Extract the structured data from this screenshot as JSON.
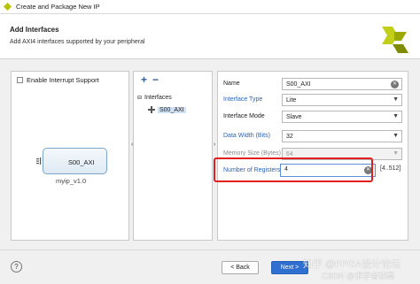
{
  "window": {
    "title": "Create and Package New IP"
  },
  "header": {
    "title": "Add Interfaces",
    "subtitle": "Add AXI4 interfaces supported by your peripheral"
  },
  "left_panel": {
    "interrupt_label": "Enable Interrupt Support",
    "interrupt_checked": false,
    "ip_block_label": "S00_AXI",
    "ip_name": "myip_v1.0"
  },
  "mid_panel": {
    "add_label": "+",
    "remove_label": "−",
    "tree_root": "Interfaces",
    "tree_child": "S00_AXI"
  },
  "properties": {
    "name_label": "Name",
    "name_value": "S00_AXI",
    "type_label": "Interface Type",
    "type_value": "Lite",
    "mode_label": "Interface Mode",
    "mode_value": "Slave",
    "width_label": "Data Width (Bits)",
    "width_value": "32",
    "memory_label": "Memory Size (Bytes)",
    "memory_value": "64",
    "registers_label": "Number of Registers",
    "registers_value": "4",
    "registers_range": "[4..512]"
  },
  "footer": {
    "help_label": "?",
    "back_label": "< Back",
    "next_label": "Next >"
  },
  "watermark": {
    "line1": "知乎 @FPGA设计论坛",
    "line2": "CSDN @求学者初亮"
  },
  "colors": {
    "accent": "#2f6fd0",
    "highlight": "#e02020",
    "link": "#2b63b8",
    "logo": "#b5c300"
  }
}
